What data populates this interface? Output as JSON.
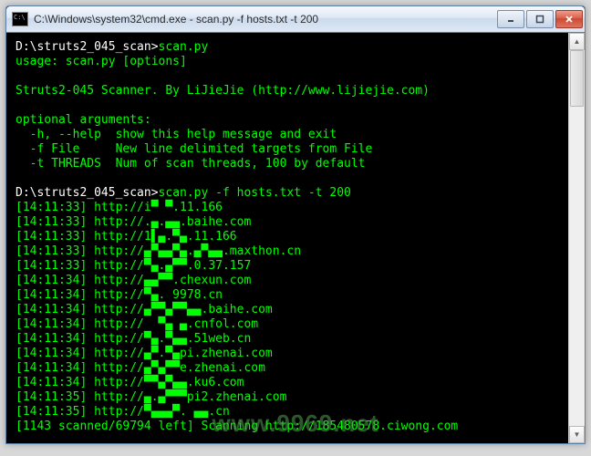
{
  "window": {
    "title": "C:\\Windows\\system32\\cmd.exe - scan.py   -f hosts.txt -t 200"
  },
  "prompt1": "D:\\struts2_045_scan>",
  "cmd1": "scan.py",
  "usage": "usage: scan.py [options]",
  "desc": "Struts2-045 Scanner. By LiJieJie (http://www.lijiejie.com)",
  "opt_header": "optional arguments:",
  "opt1": "  -h, --help  show this help message and exit",
  "opt2": "  -f File     New line delimited targets from File",
  "opt3": "  -t THREADS  Num of scan threads, 100 by default",
  "prompt2": "D:\\struts2_045_scan>",
  "cmd2": "scan.py -f hosts.txt -t 200",
  "lines": {
    "l0": "[14:11:33] http://i▀ ▀.11.166",
    "l1": "[14:11:33] http://.▄.▄▄.baihe.com",
    "l2": "[14:11:33] http://1▌▄.▀▄.11.166",
    "l3": "[14:11:33] http://▄▀▄▄▀▄.▄▀▄▄.maxthon.cn",
    "l4": "[14:11:33] http://▀▄.▄▀▀.0.37.157",
    "l5": "[14:11:34] http://▄▄▀▀.chexun.com",
    "l6": "[14:11:34] http://▀▄. 9978.cn",
    "l7": "[14:11:34] http://▄▀▀▄▀▀▄▄.baihe.com",
    "l8": "[14:11:34] http://  ▀▄ ▄.cnfol.com",
    "l9": "[14:11:34] http://▀▄.▀▄▄.51web.cn",
    "l10": "[14:11:34] http://▄▀.▀▄pi.zhenai.com",
    "l11": "[14:11:34] http://▄▀▄▀▀e.zhenai.com",
    "l12": "[14:11:34] http://▀▀▄▀▄▄.ku6.com",
    "l13": "[14:11:35] http://▄.▄▀▀▀pi2.zhenai.com",
    "l14": "[14:11:35] http://▀▄▄▄▀. ▄▄.cn"
  },
  "status": "[1143 scanned/69794 left] Scanning http://185480578.ciwong.com",
  "watermark": "www.9969.net"
}
